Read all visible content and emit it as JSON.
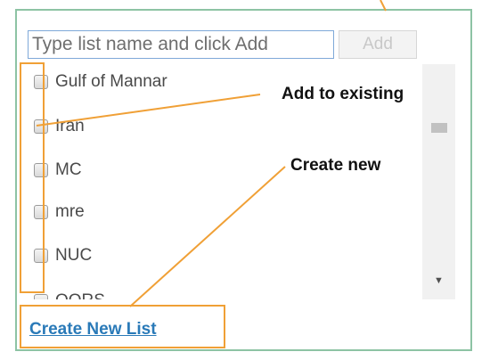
{
  "add_list": {
    "placeholder": "Type list name and click Add",
    "add_label": "Add"
  },
  "lists": [
    {
      "label": "Gulf of Mannar",
      "checked": false
    },
    {
      "label": "Iran",
      "checked": false
    },
    {
      "label": "MC",
      "checked": false
    },
    {
      "label": "mre",
      "checked": false
    },
    {
      "label": "NUC",
      "checked": false
    },
    {
      "label": "OORS",
      "checked": false
    }
  ],
  "create_new_list_label": "Create New List",
  "annotations": {
    "add_to_existing": "Add to existing",
    "create_new": "Create new"
  },
  "colors": {
    "annotation": "#f0a036",
    "panel_border": "#8dc3a4",
    "link": "#2a7ab8"
  },
  "icons": [
    "checkbox-icon",
    "scroll-down-arrow-icon"
  ]
}
